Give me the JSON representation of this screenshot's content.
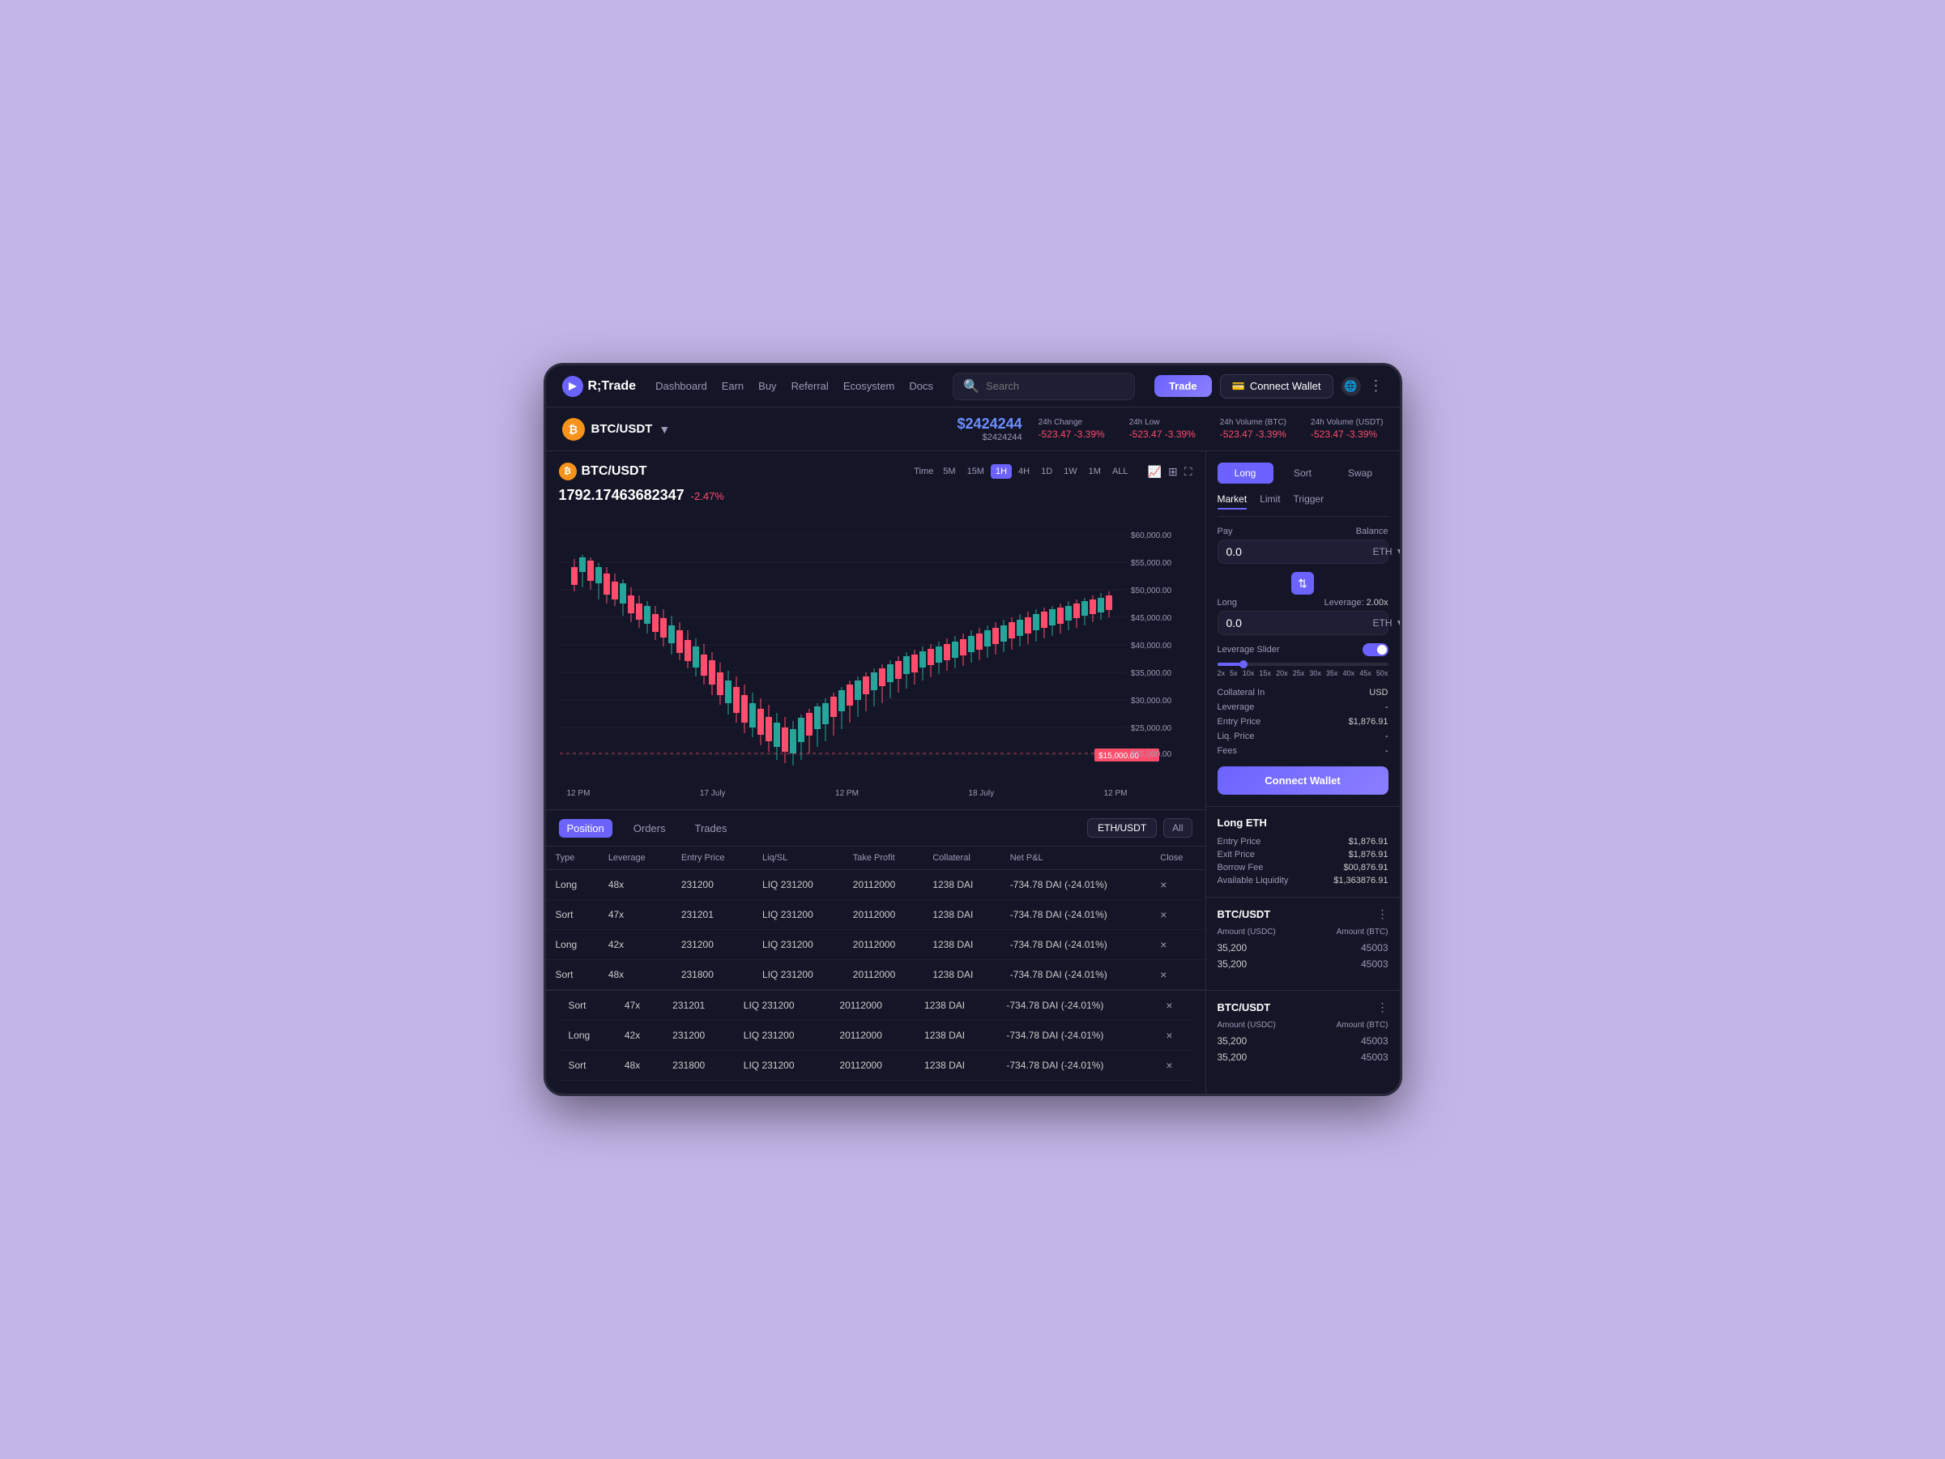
{
  "app": {
    "logo": "R;Trade",
    "nav": {
      "links": [
        "Dashboard",
        "Earn",
        "Buy",
        "Referral",
        "Ecosystem",
        "Docs"
      ],
      "search_placeholder": "Search",
      "btn_trade": "Trade",
      "btn_connect_wallet": "Connect Wallet"
    }
  },
  "ticker": {
    "pair": "BTC/USDT",
    "icon": "₿",
    "price_main": "$2424244",
    "price_sub": "$2424244",
    "change_label": "24h Change",
    "change_value": "-523.47 -3.39%",
    "low_label": "24h Low",
    "low_value": "-523.47 -3.39%",
    "vol_btc_label": "24h Volume (BTC)",
    "vol_btc_value": "-523.47 -3.39%",
    "vol_usdt_label": "24h Volume (USDT)",
    "vol_usdt_value": "-523.47 -3.39%"
  },
  "chart": {
    "pair": "BTC/USDT",
    "price": "1792.17463682347",
    "change": "-2.47%",
    "timeframes": [
      "Time",
      "5M",
      "15M",
      "1H",
      "4H",
      "1D",
      "1W",
      "1M",
      "ALL"
    ],
    "active_tf": "1H",
    "price_levels": [
      "$60,000.00",
      "$55,000.00",
      "$50,000.00",
      "$45,000.00",
      "$40,000.00",
      "$35,000.00",
      "$30,000.00",
      "$25,000.00",
      "$20,000.00",
      "$15,000.00"
    ],
    "current_price_label": "$15,000.00",
    "time_labels": [
      "12 PM",
      "17 July",
      "12 PM",
      "18 July",
      "12 PM"
    ]
  },
  "trade_form": {
    "tabs": [
      "Long",
      "Sort",
      "Swap"
    ],
    "active_tab": "Long",
    "order_types": [
      "Market",
      "Limit",
      "Trigger"
    ],
    "active_order": "Market",
    "pay_label": "Pay",
    "pay_value": "0.0",
    "balance_label": "Balance",
    "pay_currency": "ETH",
    "long_label": "Long",
    "long_value": "0.0",
    "leverage_label": "Leverage",
    "leverage_value": "2.00x",
    "long_currency": "ETH",
    "leverage_slider_label": "Leverage Slider",
    "leverage_ticks": [
      "2x",
      "5x",
      "10x",
      "15x",
      "20x",
      "25x",
      "30x",
      "35x",
      "40x",
      "45x",
      "50x"
    ],
    "collateral_in_label": "Collateral In",
    "collateral_in_value": "USD",
    "leverage_info_label": "Leverage",
    "leverage_info_value": "-",
    "entry_price_label": "Entry Price",
    "entry_price_value": "$1,876.91",
    "liq_price_label": "Liq. Price",
    "liq_price_value": "-",
    "fees_label": "Fees",
    "fees_value": "-",
    "connect_wallet_btn": "Connect Wallet"
  },
  "long_eth": {
    "title": "Long ETH",
    "entry_price_label": "Entry Price",
    "entry_price_value": "$1,876.91",
    "exit_price_label": "Exit Price",
    "exit_price_value": "$1,876.91",
    "borrow_fee_label": "Borrow Fee",
    "borrow_fee_value": "$00,876.91",
    "available_liq_label": "Available Liquidity",
    "available_liq_value": "$1,363876.91"
  },
  "orderbook": {
    "title": "BTC/USDT",
    "amount_usdc_label": "Amount (USDC)",
    "amount_btc_label": "Amount (BTC)",
    "rows": [
      {
        "price": "35,200",
        "amount": "45003"
      },
      {
        "price": "35,200",
        "amount": "45003"
      }
    ]
  },
  "positions_table": {
    "tabs": [
      "Position",
      "Orders",
      "Trades"
    ],
    "active_tab": "Position",
    "filter_pair": "ETH/USDT",
    "filter_all": "All",
    "columns": [
      "Type",
      "Leverage",
      "Entry Price",
      "Liq/SL",
      "Take Profit",
      "Collateral",
      "Net P&L",
      "Close"
    ],
    "rows": [
      {
        "type": "Long",
        "leverage": "48x",
        "entry": "231200",
        "liq": "LIQ 231200",
        "take_profit": "20112000",
        "collateral": "1238 DAI",
        "pnl": "-734.78 DAI (-24.01%)",
        "close": "×"
      },
      {
        "type": "Sort",
        "leverage": "47x",
        "entry": "231201",
        "liq": "LIQ 231200",
        "take_profit": "20112000",
        "collateral": "1238 DAI",
        "pnl": "-734.78 DAI (-24.01%)",
        "close": "×"
      },
      {
        "type": "Long",
        "leverage": "42x",
        "entry": "231200",
        "liq": "LIQ 231200",
        "take_profit": "20112000",
        "collateral": "1238 DAI",
        "pnl": "-734.78 DAI (-24.01%)",
        "close": "×"
      },
      {
        "type": "Sort",
        "leverage": "48x",
        "entry": "231800",
        "liq": "LIQ 231200",
        "take_profit": "20112000",
        "collateral": "1238 DAI",
        "pnl": "-734.78 DAI (-24.01%)",
        "close": "×"
      }
    ]
  },
  "bottom_table": {
    "rows": [
      {
        "type": "Sort",
        "leverage": "47x",
        "entry": "231201",
        "liq": "LIQ 231200",
        "take_profit": "20112000",
        "collateral": "1238 DAI",
        "pnl": "-734.78 DAI (-24.01%)",
        "close": "×"
      },
      {
        "type": "Long",
        "leverage": "42x",
        "entry": "231200",
        "liq": "LIQ 231200",
        "take_profit": "20112000",
        "collateral": "1238 DAI",
        "pnl": "-734.78 DAI (-24.01%)",
        "close": "×"
      },
      {
        "type": "Sort",
        "leverage": "48x",
        "entry": "231800",
        "liq": "LIQ 231200",
        "take_profit": "20112000",
        "collateral": "1238 DAI",
        "pnl": "-734.78 DAI (-24.01%)",
        "close": "×"
      }
    ]
  },
  "bottom_orderbook": {
    "title": "BTC/USDT",
    "amount_usdc_label": "Amount (USDC)",
    "amount_btc_label": "Amount (BTC)",
    "rows": [
      {
        "price": "35,200",
        "amount": "45003"
      },
      {
        "price": "35,200",
        "amount": "45003"
      }
    ]
  }
}
